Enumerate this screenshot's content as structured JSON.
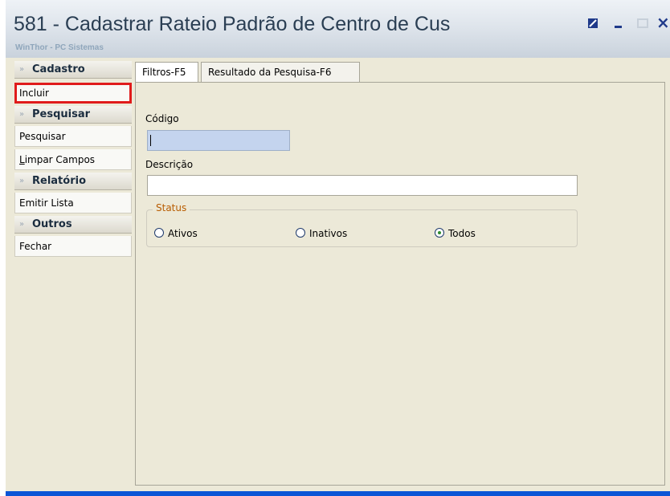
{
  "window": {
    "title": "581 - Cadastrar Rateio Padrão de Centro de Cus",
    "subtitle": "WinThor - PC Sistemas",
    "controls": {
      "close": "×"
    }
  },
  "sidebar": {
    "groups": [
      {
        "label": "Cadastro",
        "items": [
          {
            "label": "Incluir"
          }
        ]
      },
      {
        "label": "Pesquisar",
        "items": [
          {
            "label": "Pesquisar"
          },
          {
            "label_mnemonic": "L",
            "label_rest": "impar Campos"
          }
        ]
      },
      {
        "label": "Relatório",
        "items": [
          {
            "label": "Emitir Lista"
          }
        ]
      },
      {
        "label": "Outros",
        "items": [
          {
            "label": "Fechar"
          }
        ]
      }
    ],
    "chevron": "»"
  },
  "tabs": [
    {
      "label": "Filtros-F5"
    },
    {
      "label": "Resultado da Pesquisa-F6"
    }
  ],
  "form": {
    "codigo_label": "Código",
    "codigo_value": "",
    "descricao_label": "Descrição",
    "descricao_value": "",
    "status_label": "Status",
    "status_options": [
      "Ativos",
      "Inativos",
      "Todos"
    ],
    "status_selected": "Todos"
  },
  "colors": {
    "window_border": "#0b55d6",
    "highlight": "#e01b1b",
    "status_legend": "#b85c00"
  }
}
